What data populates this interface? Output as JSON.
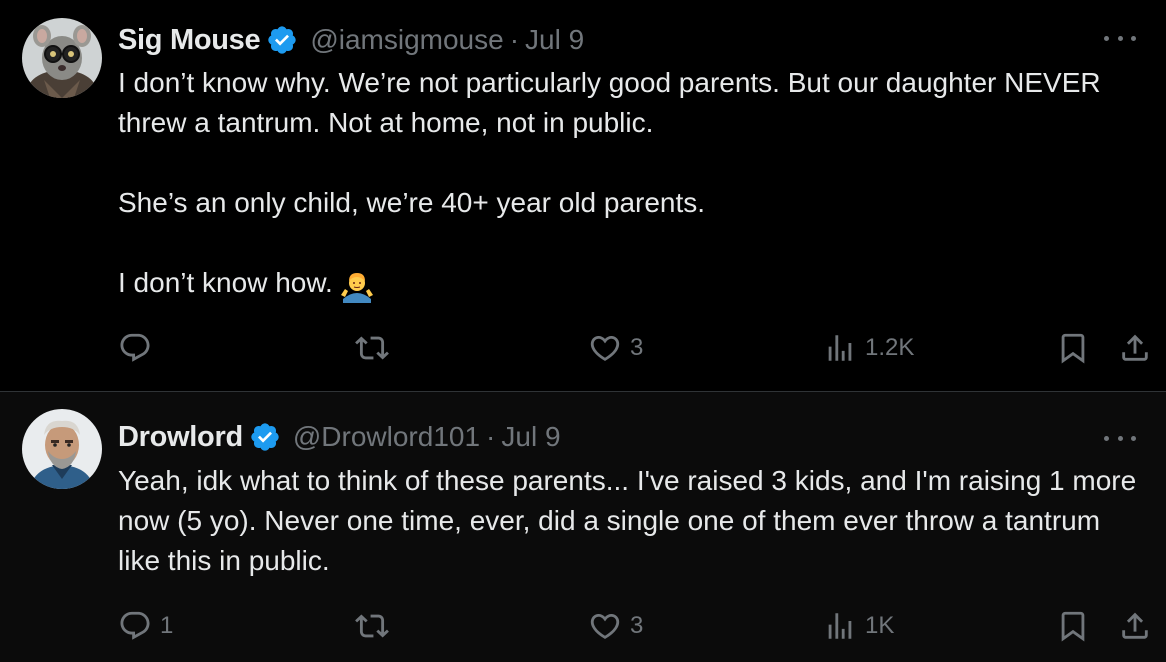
{
  "tweets": [
    {
      "name": "Sig Mouse",
      "handle": "@iamsigmouse",
      "separator": "·",
      "date": "Jul 9",
      "verified": true,
      "avatar_icon": "avatar-mouse-with-glasses",
      "body": [
        "I don’t know why. We’re not particularly good parents. But our daughter NEVER threw a tantrum. Not at home, not in public.",
        "She’s an only child, we’re 40+ year old parents.",
        "I don’t know how."
      ],
      "emoji": "man-shrugging-emoji",
      "stats": {
        "replies": "",
        "reposts": "",
        "likes": "3",
        "views": "1.2K"
      }
    },
    {
      "name": "Drowlord",
      "handle": "@Drowlord101",
      "separator": "·",
      "date": "Jul 9",
      "verified": true,
      "avatar_icon": "avatar-bearded-man",
      "body": [
        "Yeah, idk what to think of these parents... I've raised 3 kids, and I'm raising 1 more now (5 yo).  Never one time, ever, did a single one of them ever throw a tantrum like this in public."
      ],
      "stats": {
        "replies": "1",
        "reposts": "",
        "likes": "3",
        "views": "1K"
      }
    }
  ],
  "colors": {
    "background": "#000000",
    "text": "#e7e9ea",
    "muted": "#71767b",
    "verified": "#1d9bf0",
    "divider": "#2f3336"
  }
}
